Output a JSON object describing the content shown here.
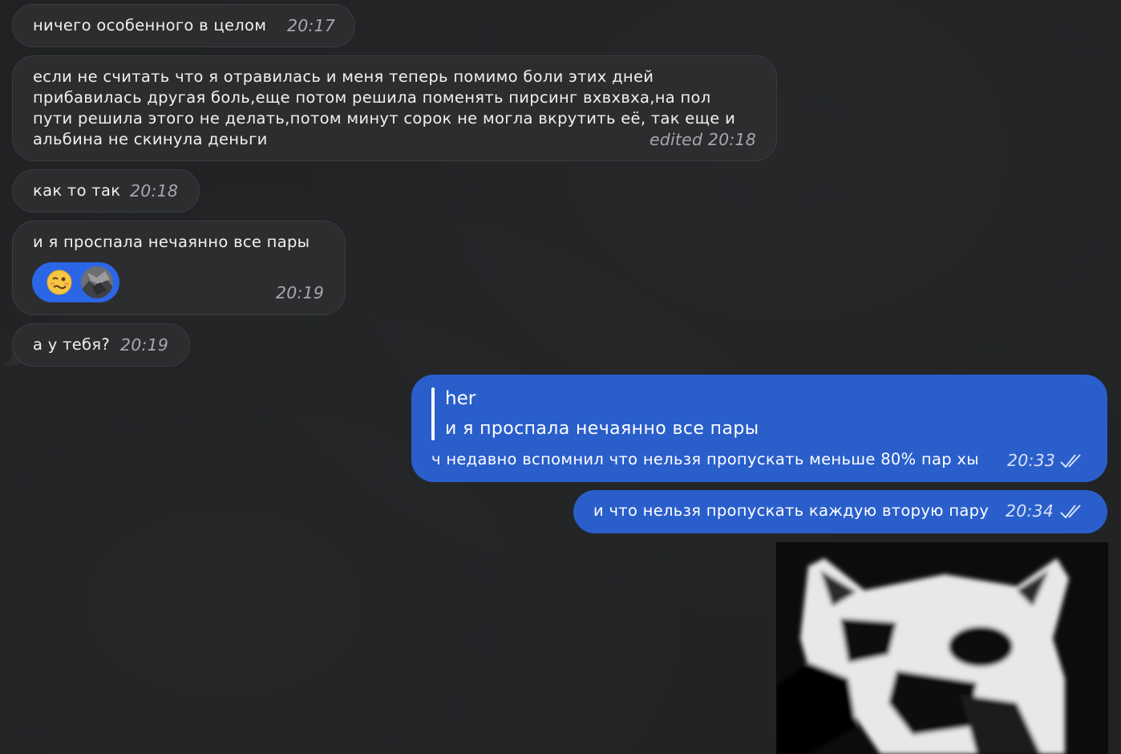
{
  "chat": {
    "incoming": [
      {
        "text": "ничего особенного в целом",
        "time": "20:17"
      },
      {
        "lines": [
          "если не считать что я отравилась и меня теперь помимо боли этих дней",
          "прибавилась другая боль,еще потом решила поменять пирсинг вхвхвха,на пол",
          "пути решила этого не делать,потом минут сорок не могла вкрутить её, так еще и",
          "альбина не скинула деньги"
        ],
        "time": "edited 20:18"
      },
      {
        "text": "как то так",
        "time": "20:18"
      },
      {
        "text": "и я проспала нечаянно все пары",
        "time": "20:19",
        "reaction": {
          "emoji": "woozy-face",
          "count_avatars": 1
        }
      },
      {
        "text": "а у тебя?",
        "time": "20:19"
      }
    ],
    "outgoing": [
      {
        "quote_author": "her",
        "quote_text": "и я проспала нечаянно все пары",
        "text": "ч недавно вспомнил что нельзя пропускать меньше 80% пар хы",
        "time": "20:33",
        "status": "read"
      },
      {
        "text": "и что нельзя пропускать каждую вторую пару",
        "time": "20:34",
        "status": "read"
      }
    ],
    "image_message": {
      "description_icon": "photo-message"
    }
  },
  "colors": {
    "background": "#202224",
    "incoming_bubble": "#2c2d2f",
    "outgoing_bubble": "#2a5fcb",
    "reaction_pill": "#2b66e6",
    "time_incoming": "#a7a8ab"
  }
}
